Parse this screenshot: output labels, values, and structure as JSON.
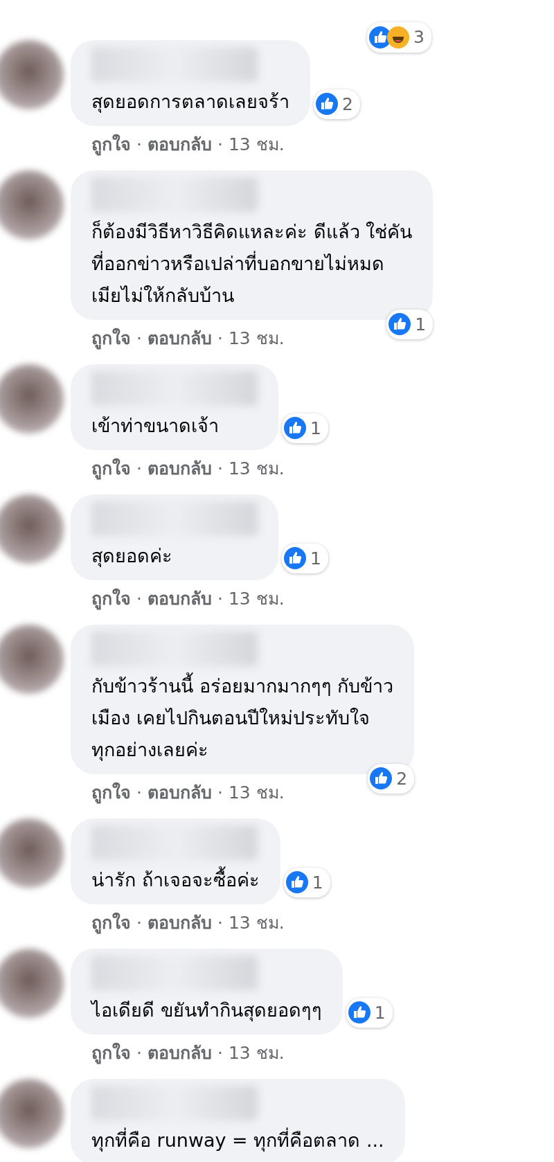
{
  "previous_comment": {
    "reaction_count": "3"
  },
  "comments": [
    {
      "text_lines": [
        "สุดยอดการตลาดเลยจร้า"
      ],
      "like_count": "2",
      "actions": [
        {
          "kind": "link",
          "text": "ถูกใจ"
        },
        {
          "kind": "dot",
          "text": "·"
        },
        {
          "kind": "link",
          "text": "ตอบกลับ"
        },
        {
          "kind": "dot",
          "text": "·"
        },
        {
          "kind": "time",
          "text": "13 ชม."
        }
      ]
    },
    {
      "text_lines": [
        "ก็ต้องมีวิธีหาวิธีคิดแหละค่ะ ดีแล้ว ใช่คัน",
        "ที่ออกข่าวหรือเปล่าที่บอกขายไม่หมด",
        "เมียไม่ให้กลับบ้าน"
      ],
      "like_count": "1",
      "actions": [
        {
          "kind": "link",
          "text": "ถูกใจ"
        },
        {
          "kind": "dot",
          "text": "·"
        },
        {
          "kind": "link",
          "text": "ตอบกลับ"
        },
        {
          "kind": "dot",
          "text": "·"
        },
        {
          "kind": "time",
          "text": "13 ชม."
        }
      ]
    },
    {
      "text_lines": [
        "เข้าท่าขนาดเจ้า"
      ],
      "like_count": "1",
      "actions": [
        {
          "kind": "link",
          "text": "ถูกใจ"
        },
        {
          "kind": "dot",
          "text": "·"
        },
        {
          "kind": "link",
          "text": "ตอบกลับ"
        },
        {
          "kind": "dot",
          "text": "·"
        },
        {
          "kind": "time",
          "text": "13 ชม."
        }
      ]
    },
    {
      "text_lines": [
        "สุดยอดค่ะ"
      ],
      "like_count": "1",
      "actions": [
        {
          "kind": "link",
          "text": "ถูกใจ"
        },
        {
          "kind": "dot",
          "text": "·"
        },
        {
          "kind": "link",
          "text": "ตอบกลับ"
        },
        {
          "kind": "dot",
          "text": "·"
        },
        {
          "kind": "time",
          "text": "13 ชม."
        }
      ]
    },
    {
      "text_lines": [
        "กับข้าวร้านนี้ อร่อยมากมากๆๆ กับข้าว",
        "เมือง เคยไปกินตอนปีใหม่ประทับใจ",
        "ทุกอย่างเลยค่ะ"
      ],
      "like_count": "2",
      "actions": [
        {
          "kind": "link",
          "text": "ถูกใจ"
        },
        {
          "kind": "dot",
          "text": "·"
        },
        {
          "kind": "link",
          "text": "ตอบกลับ"
        },
        {
          "kind": "dot",
          "text": "·"
        },
        {
          "kind": "time",
          "text": "13 ชม."
        }
      ]
    },
    {
      "text_lines": [
        "น่ารัก ถ้าเจอจะซื้อค่ะ"
      ],
      "like_count": "1",
      "actions": [
        {
          "kind": "link",
          "text": "ถูกใจ"
        },
        {
          "kind": "dot",
          "text": "·"
        },
        {
          "kind": "link",
          "text": "ตอบกลับ"
        },
        {
          "kind": "dot",
          "text": "·"
        },
        {
          "kind": "time",
          "text": "13 ชม."
        }
      ]
    },
    {
      "text_lines": [
        "ไอเดียดี ขยันทำกินสุดยอดๆๆ"
      ],
      "like_count": "1",
      "actions": [
        {
          "kind": "link",
          "text": "ถูกใจ"
        },
        {
          "kind": "dot",
          "text": "·"
        },
        {
          "kind": "link",
          "text": "ตอบกลับ"
        },
        {
          "kind": "dot",
          "text": "·"
        },
        {
          "kind": "time",
          "text": "13 ชม."
        }
      ]
    },
    {
      "text_lines": [
        "ทุกที่คือ runway = ทุกที่คือตลาด ..."
      ]
    }
  ]
}
